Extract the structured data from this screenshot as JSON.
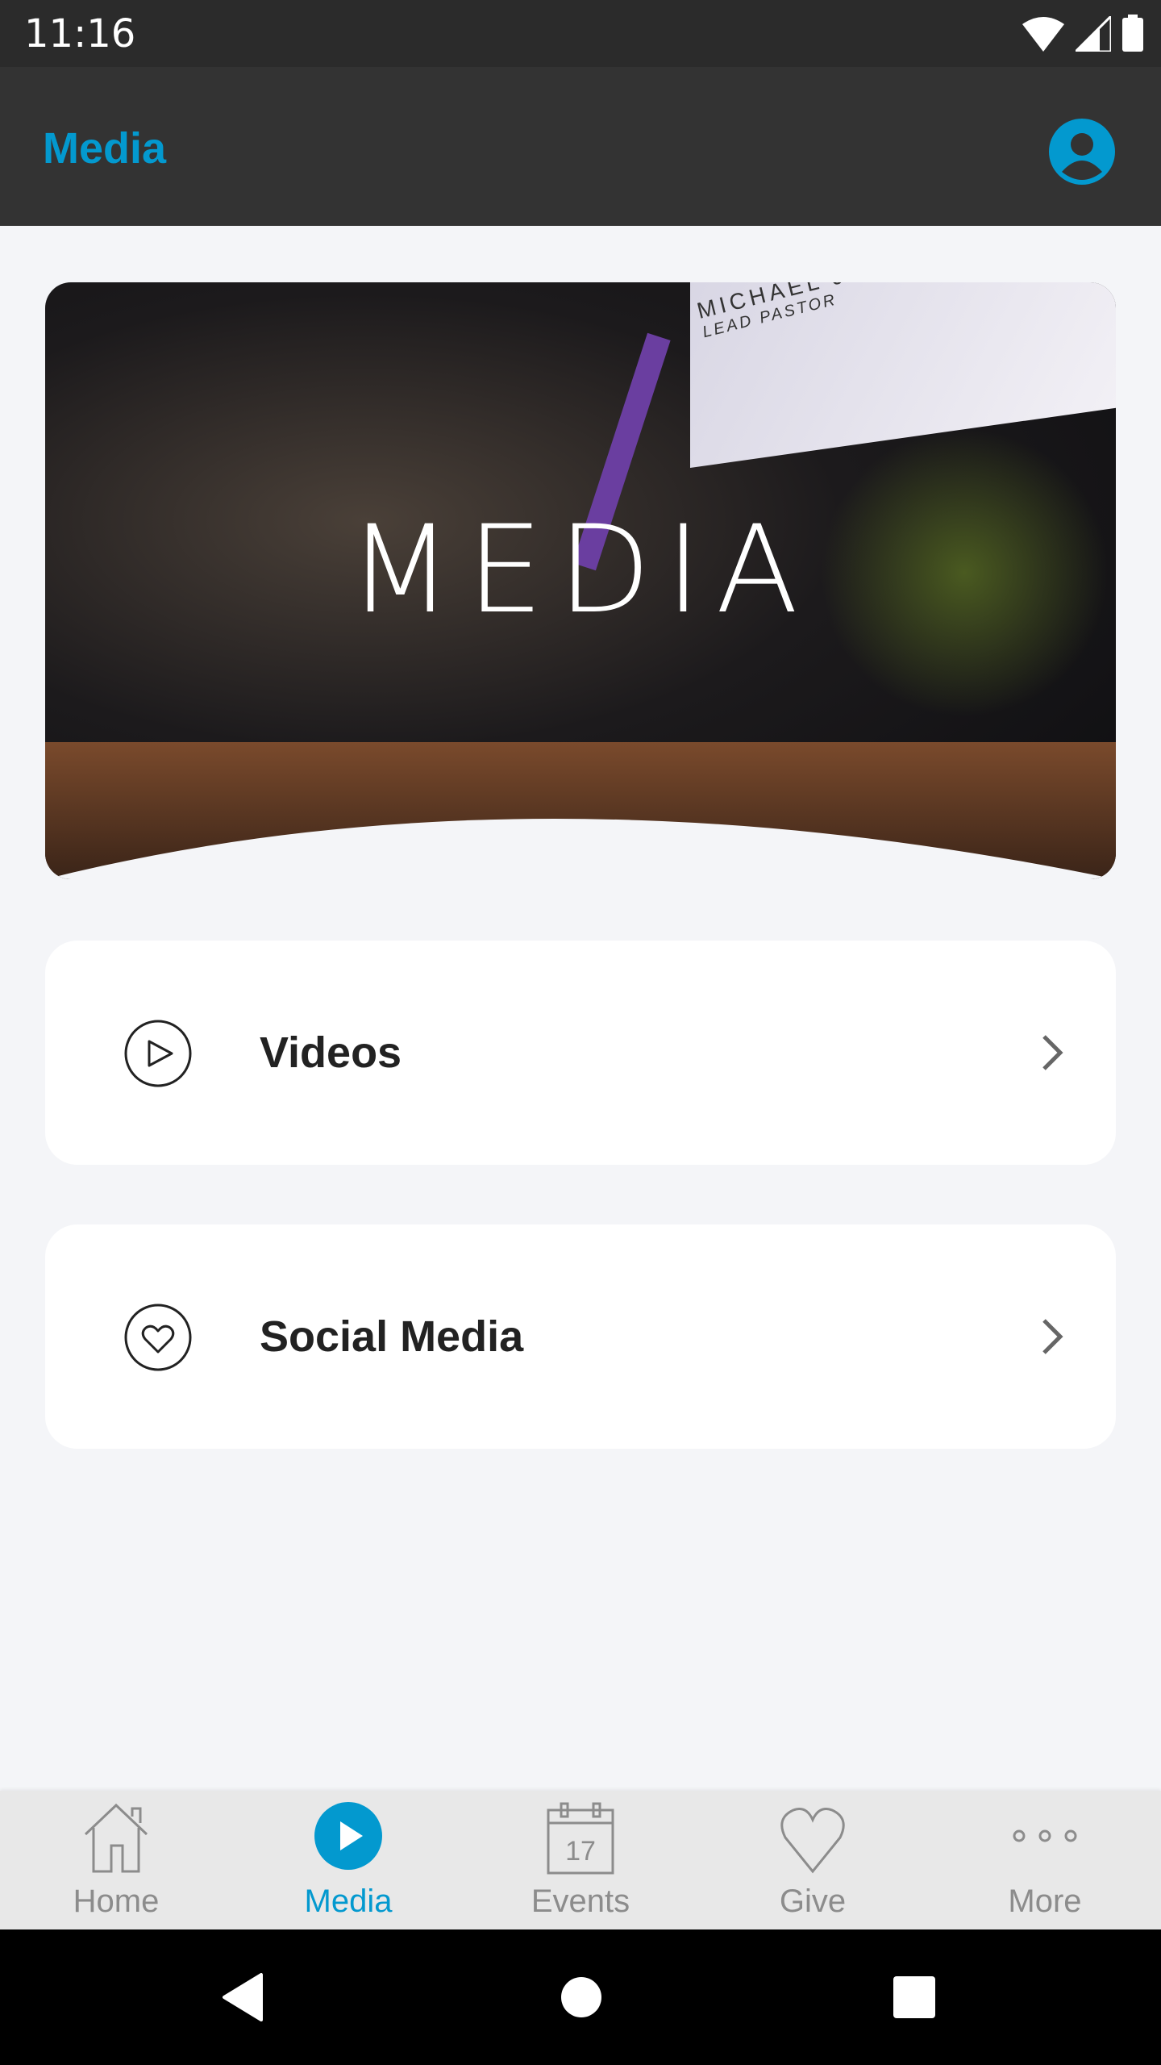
{
  "status_bar": {
    "time": "11:16"
  },
  "app_bar": {
    "title": "Media",
    "profile_icon": "account-circle-icon"
  },
  "hero": {
    "heading": "MEDIA",
    "screen_name": "MICHAEL JA",
    "screen_role": "LEAD PASTOR"
  },
  "menu": [
    {
      "label": "Videos",
      "icon": "play-circle-icon"
    },
    {
      "label": "Social Media",
      "icon": "heart-circle-icon"
    }
  ],
  "bottom_nav": {
    "active": "Media",
    "accent": "#0399cf",
    "items": [
      {
        "label": "Home",
        "icon": "home-icon"
      },
      {
        "label": "Media",
        "icon": "play-icon"
      },
      {
        "label": "Events",
        "icon": "calendar-icon",
        "calendar_day": "17"
      },
      {
        "label": "Give",
        "icon": "heart-icon"
      },
      {
        "label": "More",
        "icon": "more-icon"
      }
    ]
  }
}
